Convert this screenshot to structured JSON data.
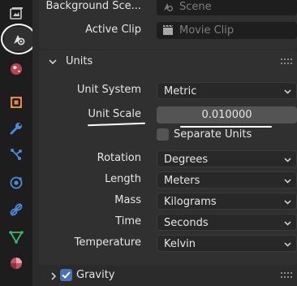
{
  "tabs": [
    {
      "icon": "render-icon"
    },
    {
      "icon": "scene-icon",
      "active": true
    },
    {
      "icon": "world-icon"
    },
    {
      "icon": "object-icon"
    },
    {
      "icon": "modifier-wrench-icon"
    },
    {
      "icon": "particles-icon"
    },
    {
      "icon": "physics-icon"
    },
    {
      "icon": "constraints-icon"
    },
    {
      "icon": "data-icon"
    },
    {
      "icon": "material-icon"
    }
  ],
  "scene_panel": {
    "background_scene_label": "Background Sce...",
    "background_scene_placeholder": "Scene",
    "active_clip_label": "Active Clip",
    "active_clip_placeholder": "Movie Clip"
  },
  "units": {
    "title": "Units",
    "unit_system_label": "Unit System",
    "unit_system_value": "Metric",
    "unit_scale_label": "Unit Scale",
    "unit_scale_value": "0.010000",
    "separate_units_label": "Separate Units",
    "separate_units_checked": false,
    "rotation_label": "Rotation",
    "rotation_value": "Degrees",
    "length_label": "Length",
    "length_value": "Meters",
    "mass_label": "Mass",
    "mass_value": "Kilograms",
    "time_label": "Time",
    "time_value": "Seconds",
    "temperature_label": "Temperature",
    "temperature_value": "Kelvin"
  },
  "gravity": {
    "label": "Gravity",
    "checked": true
  },
  "colors": {
    "accent": "#4772b3",
    "annotation": "#ffffff"
  }
}
